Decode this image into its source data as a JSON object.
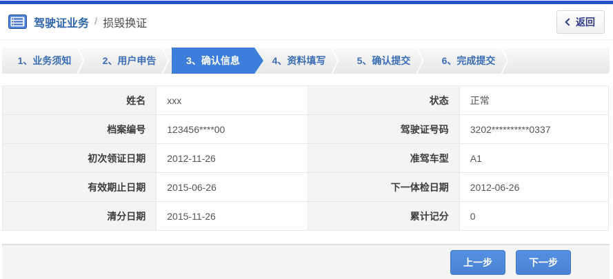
{
  "colors": {
    "topbar": "#2353c6",
    "accent": "#3d7edb",
    "title-blue": "#2e64ae",
    "step-text": "#3a6db5",
    "back-text": "#2e3a8c",
    "button-blue": "#4a86d9"
  },
  "header": {
    "title": "驾驶证业务",
    "separator": "/",
    "current": "损毁换证",
    "back_label": "返回"
  },
  "steps": {
    "active_index": 2,
    "items": [
      {
        "label": "1、业务须知"
      },
      {
        "label": "2、用户申告"
      },
      {
        "label": "3、确认信息"
      },
      {
        "label": "4、资料填写"
      },
      {
        "label": "5、确认提交"
      },
      {
        "label": "6、完成提交"
      }
    ]
  },
  "info": {
    "rows": [
      {
        "left": {
          "label": "姓名",
          "value": "xxx"
        },
        "right": {
          "label": "状态",
          "value": "正常"
        }
      },
      {
        "left": {
          "label": "档案编号",
          "value": "123456****00"
        },
        "right": {
          "label": "驾驶证号码",
          "value": "3202**********0337"
        }
      },
      {
        "left": {
          "label": "初次领证日期",
          "value": "2012-11-26"
        },
        "right": {
          "label": "准驾车型",
          "value": "A1"
        }
      },
      {
        "left": {
          "label": "有效期止日期",
          "value": "2015-06-26"
        },
        "right": {
          "label": "下一体检日期",
          "value": "2012-06-26"
        }
      },
      {
        "left": {
          "label": "清分日期",
          "value": "2015-11-26"
        },
        "right": {
          "label": "累计记分",
          "value": "0"
        }
      }
    ]
  },
  "footer": {
    "prev_label": "上一步",
    "next_label": "下一步"
  }
}
